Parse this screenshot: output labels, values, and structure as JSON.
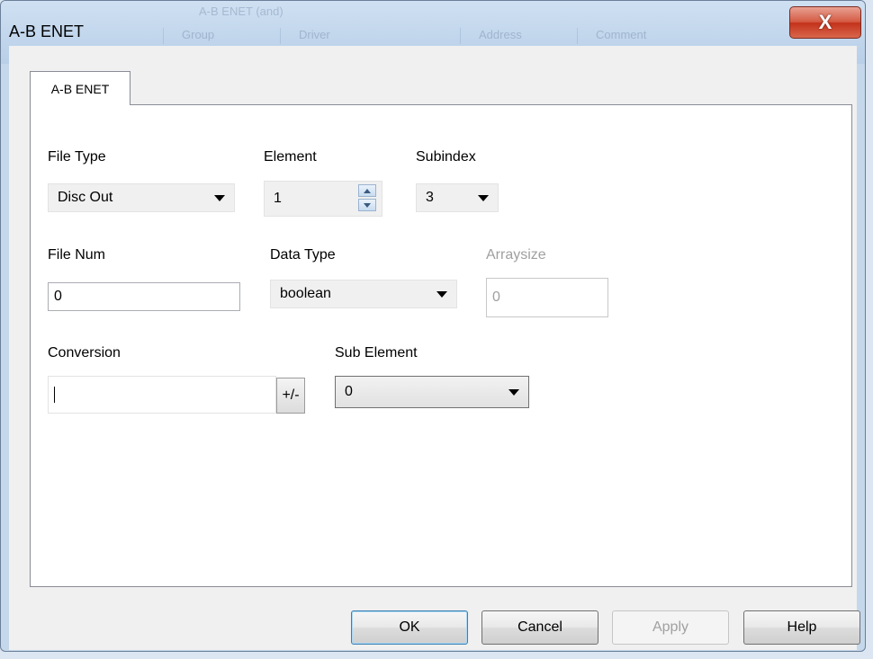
{
  "window": {
    "title": "A-B ENET",
    "close_glyph": "X",
    "background_tab_title": "A-B ENET (and)",
    "background_columns": [
      "Group",
      "Driver",
      "Address",
      "Comment"
    ]
  },
  "tabs": [
    {
      "label": "A-B ENET",
      "selected": true
    }
  ],
  "form": {
    "file_type": {
      "label": "File Type",
      "value": "Disc Out"
    },
    "element": {
      "label": "Element",
      "value": "1"
    },
    "subindex": {
      "label": "Subindex",
      "value": "3"
    },
    "file_num": {
      "label": "File Num",
      "value": "0"
    },
    "data_type": {
      "label": "Data Type",
      "value": "boolean"
    },
    "arraysize": {
      "label": "Arraysize",
      "value": "0",
      "disabled": true
    },
    "conversion": {
      "label": "Conversion",
      "value": "",
      "toggle_label": "+/-"
    },
    "sub_element": {
      "label": "Sub Element",
      "value": "0"
    }
  },
  "buttons": {
    "ok": "OK",
    "cancel": "Cancel",
    "apply": "Apply",
    "help": "Help"
  },
  "icons": {
    "close": "close-icon",
    "dropdown": "chevron-down-icon",
    "spin_up": "spin-up-icon",
    "spin_down": "spin-down-icon"
  },
  "colors": {
    "close_button": "#c3321a",
    "title_bar": "#c5d7ea",
    "default_button_border": "#3c7fb1",
    "disabled_text": "#a0a0a0"
  }
}
